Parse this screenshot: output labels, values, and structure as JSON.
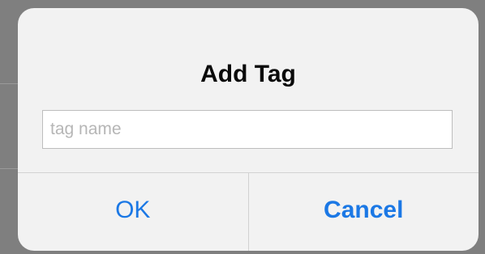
{
  "dialog": {
    "title": "Add Tag",
    "input": {
      "placeholder": "tag name",
      "value": ""
    },
    "buttons": {
      "ok_label": "OK",
      "cancel_label": "Cancel"
    },
    "accent_color": "#1b78e5"
  }
}
